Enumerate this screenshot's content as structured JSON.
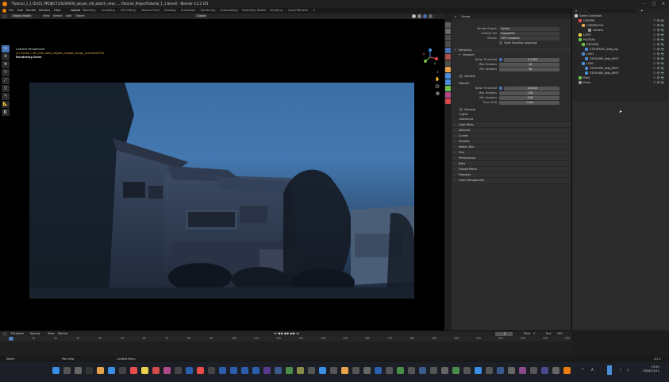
{
  "window": {
    "title": "*Tutorial_1_1 [D:\\01_PROJECT\\20240930_ukiyoe_mtl_sketch_new\\......\\Tutorial_Project\\Tutorial_1_1.blend] - Blender 4.2.2 LTS"
  },
  "menubar": {
    "items": [
      "File",
      "Edit",
      "Render",
      "Window",
      "Help"
    ],
    "workspaces": [
      "Layout",
      "Modeling",
      "Sculpting",
      "UV Editing",
      "Texture Paint",
      "Shading",
      "Animation",
      "Rendering",
      "Compositing",
      "Geometry Nodes",
      "Scripting",
      "Quad Remesh"
    ],
    "active_workspace": "Layout",
    "scene_label": "Scene",
    "view_layer_label": "ViewLayer"
  },
  "viewport": {
    "header_items": [
      "Object Mode",
      "View",
      "Select",
      "Add",
      "Object"
    ],
    "transform": "Global",
    "overlay_perspective": "Camera Perspective",
    "overlay_frame": "(1) Scene | mtl_fine_ladd_ukiyoe_cuppot_soupy_scurrried.030",
    "overlay_status": "Rendering Done"
  },
  "properties": {
    "header_label": "Scene",
    "render_engine_label": "Render Engine",
    "render_engine_value": "Cycles",
    "feature_set_label": "Feature Set",
    "feature_set_value": "Supported",
    "device_label": "Device",
    "device_value": "GPU Compute",
    "osl_label": "Open Shading Language",
    "sampling_label": "Sampling",
    "viewport_label": "Viewport",
    "noise_threshold_label": "Noise Threshold",
    "vp_noise_threshold": "0.1000",
    "max_samples_label": "Max Samples",
    "vp_max_samples": "16",
    "min_samples_label": "Min Samples",
    "vp_min_samples": "16",
    "denoise_label": "Denoise",
    "render_label": "Render",
    "r_noise_threshold": "0.0100",
    "r_max_samples": "128",
    "r_min_samples": "128",
    "time_limit_label": "Time Limit",
    "r_time_limit": "0 sec",
    "denoise2_label": "Denoise",
    "lights_label": "Lights",
    "advanced_label": "Advanced",
    "sections": [
      "Light Paths",
      "Volumes",
      "Curves",
      "Simplify",
      "Motion Blur",
      "Film",
      "Performance",
      "Bake",
      "Grease Pencil",
      "Freestyle",
      "Color Management"
    ]
  },
  "outliner": {
    "title": "Scene Collection",
    "rows": [
      {
        "label": "CAMERA",
        "color": "#e84c4c"
      },
      {
        "label": "CAMERA.001",
        "color": "#e8a24c"
      },
      {
        "label": "Camera",
        "color": "#9a9a9a"
      },
      {
        "label": "LIGHT",
        "color": "#e8d24c"
      },
      {
        "label": "PLATEAU",
        "color": "#6cc24a"
      },
      {
        "label": "GROUND",
        "color": "#6cc24a"
      },
      {
        "label": "ST2HH4001_bldg_kg..",
        "color": "#4a8cd9"
      },
      {
        "label": "LOD1",
        "color": "#4a8cd9"
      },
      {
        "label": "53394485_bldg_6697",
        "color": "#4a8cd9"
      },
      {
        "label": "LOD2",
        "color": "#4a8cd9"
      },
      {
        "label": "53394485_bldg_6697",
        "color": "#4a8cd9"
      },
      {
        "label": "53394485_bldg_6697",
        "color": "#4a8cd9"
      },
      {
        "label": "Plant",
        "color": "#6cc24a"
      },
      {
        "label": "Plane",
        "color": "#9a9a9a"
      }
    ]
  },
  "timeline": {
    "header_items": [
      "Playback",
      "Keying",
      "View",
      "Marker"
    ],
    "ticks": [
      "0",
      "10",
      "20",
      "30",
      "40",
      "50",
      "60",
      "70",
      "80",
      "90",
      "100",
      "110",
      "120",
      "130",
      "140",
      "150",
      "160",
      "170",
      "180",
      "190",
      "200",
      "210",
      "220",
      "230",
      "240",
      "250"
    ],
    "current_frame": "1",
    "start_label": "Start",
    "start_value": "1",
    "end_label": "End",
    "end_value": "250"
  },
  "statusbar": {
    "items": [
      "Select",
      "Pan View",
      "Context Menu"
    ],
    "version": "4.2.2"
  },
  "taskbar": {
    "time": "13:41",
    "date": "2024/11/11",
    "lang": "A"
  }
}
